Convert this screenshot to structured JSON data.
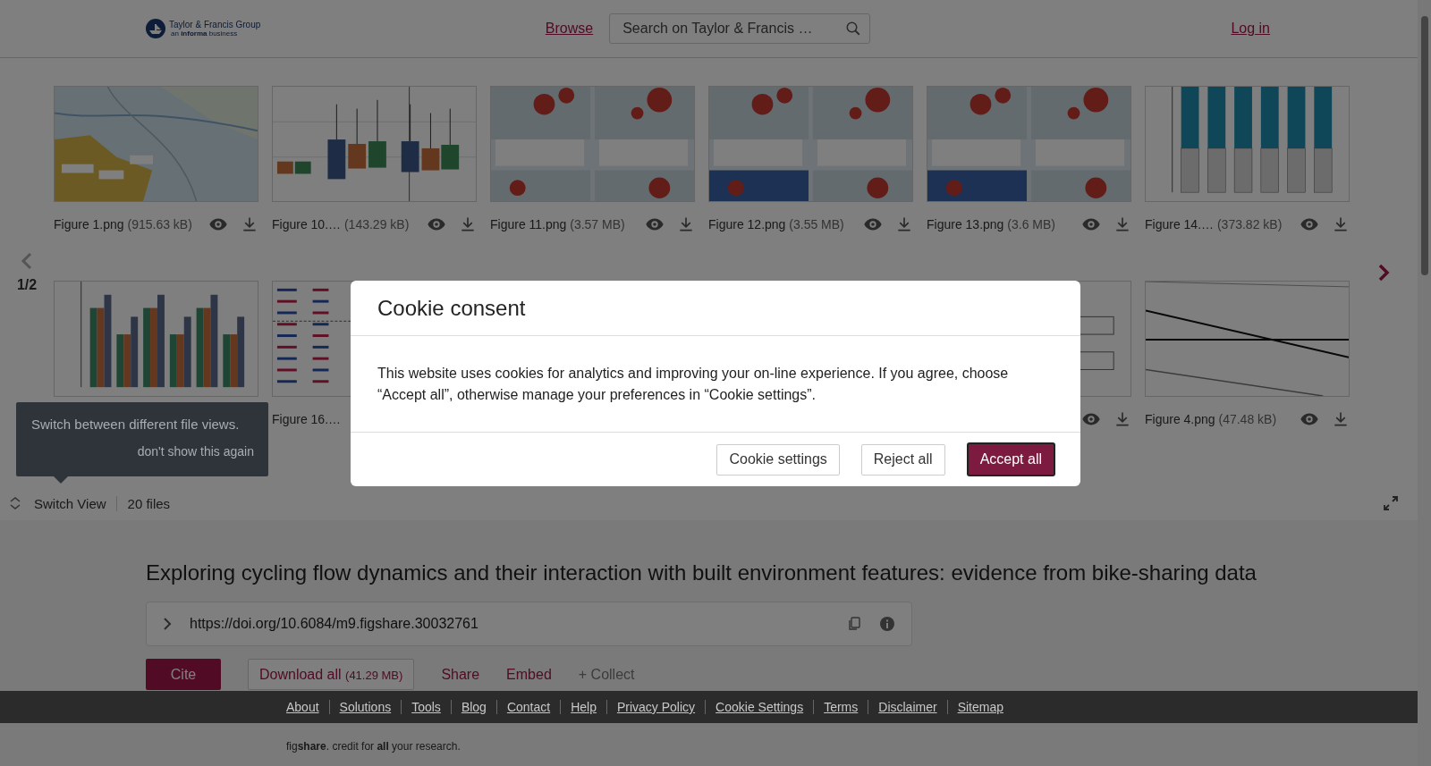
{
  "header": {
    "logo": {
      "name": "Taylor & Francis Group",
      "tagline": "an **informa** business"
    },
    "nav_link": "Browse",
    "search": {
      "placeholder": "Search on Taylor & Francis …"
    },
    "login": "Log in"
  },
  "gallery": {
    "page": "1/2",
    "rows": [
      [
        {
          "kind": "file",
          "name": "Figure 1.png",
          "size": "(915.63 kB)"
        },
        {
          "kind": "file",
          "name": "Figure 10.…",
          "size": "(143.29 kB)"
        },
        {
          "kind": "file",
          "name": "Figure 11.png",
          "size": "(3.57 MB)"
        },
        {
          "kind": "file",
          "name": "Figure 12.png",
          "size": "(3.55 MB)"
        },
        {
          "kind": "file",
          "name": "Figure 13.png",
          "size": "(3.6 MB)"
        },
        {
          "kind": "file",
          "name": "Figure 14.…",
          "size": "(373.82 kB)"
        }
      ],
      [
        {
          "kind": "thumb"
        },
        {
          "kind": "label",
          "name": "Figure 16.…"
        },
        {
          "kind": "covered"
        },
        {
          "kind": "covered"
        },
        {
          "kind": "icons"
        },
        {
          "kind": "file",
          "name": "Figure 4.png",
          "size": "(47.48 kB)"
        }
      ]
    ],
    "switch_view": "Switch View",
    "file_count": "20 files",
    "tooltip": {
      "text": "Switch between different file views.",
      "dismiss": "don't show this again"
    }
  },
  "article": {
    "title": "Exploring cycling flow dynamics and their interaction with built environment features: evidence from bike-sharing data",
    "doi": "https://doi.org/10.6084/m9.figshare.30032761",
    "actions": [
      {
        "kind": "primary",
        "label": "Cite"
      },
      {
        "kind": "outline",
        "label": "Download all",
        "size": "(41.29 MB)"
      },
      {
        "kind": "link",
        "label": "Share"
      },
      {
        "kind": "link",
        "label": "Embed"
      },
      {
        "kind": "muted",
        "label": "+ Collect"
      }
    ]
  },
  "footer": {
    "links": [
      "About",
      "Solutions",
      "Tools",
      "Blog",
      "Contact",
      "Help",
      "Privacy Policy",
      "Cookie Settings",
      "Terms",
      "Disclaimer",
      "Sitemap"
    ],
    "credit": "fig**share**. credit for **all** your research."
  },
  "cookie_dialog": {
    "title": "Cookie consent",
    "message": "This website uses cookies for analytics and improving your on-line experience. If you agree, choose “Accept all”, otherwise manage your preferences in “Cookie settings”.",
    "buttons": [
      {
        "kind": "secondary",
        "label": "Cookie settings"
      },
      {
        "kind": "secondary",
        "label": "Reject all"
      },
      {
        "kind": "primary",
        "label": "Accept all"
      }
    ]
  }
}
